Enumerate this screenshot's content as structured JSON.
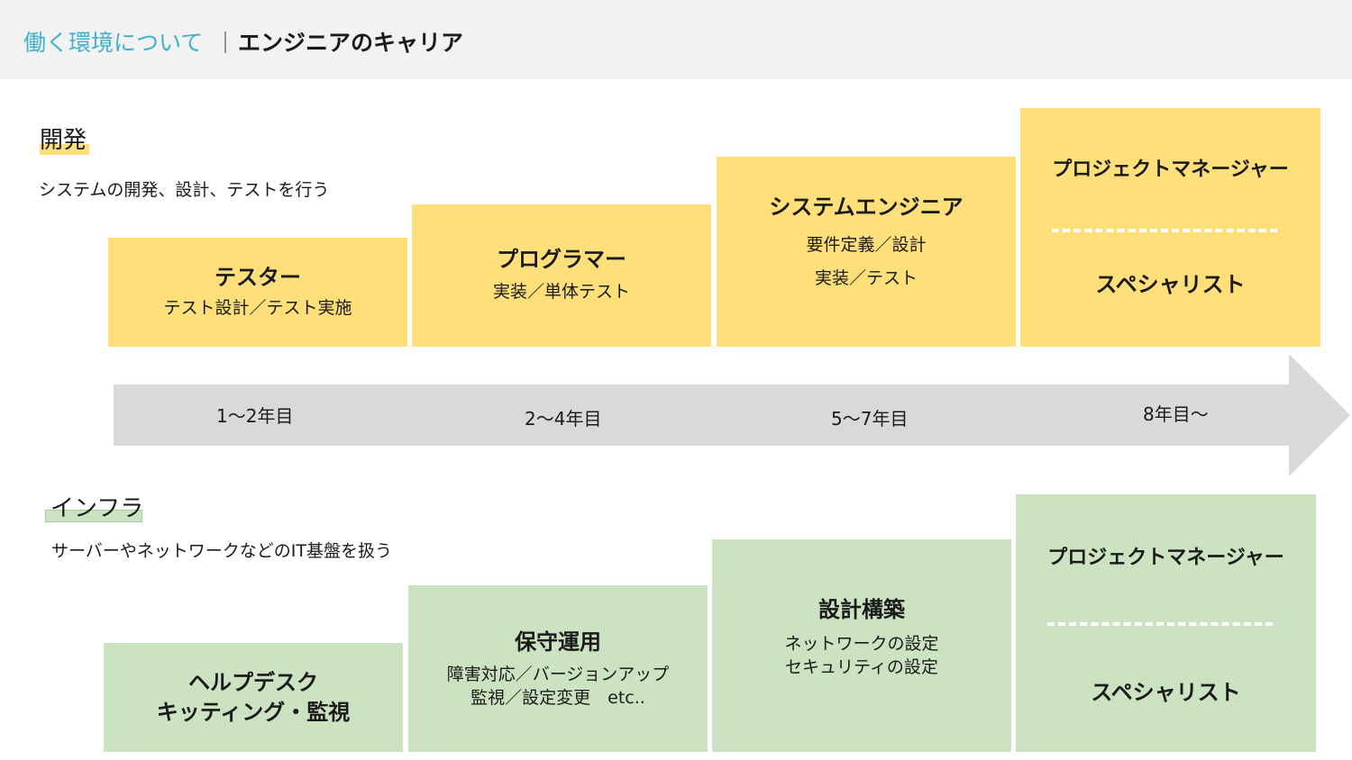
{
  "header": {
    "breadcrumb": "働く環境について",
    "separator": "｜",
    "title": "エンジニアのキャリア"
  },
  "colors": {
    "dev": "#ffdf7a",
    "infra": "#cce3c1",
    "arrow": "#d9d9d9",
    "accent": "#3fb0cf"
  },
  "development": {
    "title": "開発",
    "description": "システムの開発、設計、テストを行う",
    "stages": [
      {
        "title": "テスター",
        "subtitle": "テスト設計／テスト実施"
      },
      {
        "title": "プログラマー",
        "subtitle": "実装／単体テスト"
      },
      {
        "title": "システムエンジニア",
        "subtitle": "要件定義／設計\n実装／テスト"
      },
      {
        "title_top": "プロジェクトマネージャー",
        "title_bottom": "スペシャリスト"
      }
    ]
  },
  "timeline": {
    "years": [
      "1～2年目",
      "2～4年目",
      "5～7年目",
      "8年目～"
    ]
  },
  "infrastructure": {
    "title": "インフラ",
    "description": "サーバーやネットワークなどのIT基盤を扱う",
    "stages": [
      {
        "title": "ヘルプデスク\nキッティング・監視",
        "subtitle": ""
      },
      {
        "title": "保守運用",
        "subtitle": "障害対応／バージョンアップ\n監視／設定変更　etc.."
      },
      {
        "title": "設計構築",
        "subtitle": "ネットワークの設定\nセキュリティの設定"
      },
      {
        "title_top": "プロジェクトマネージャー",
        "title_bottom": "スペシャリスト"
      }
    ]
  }
}
